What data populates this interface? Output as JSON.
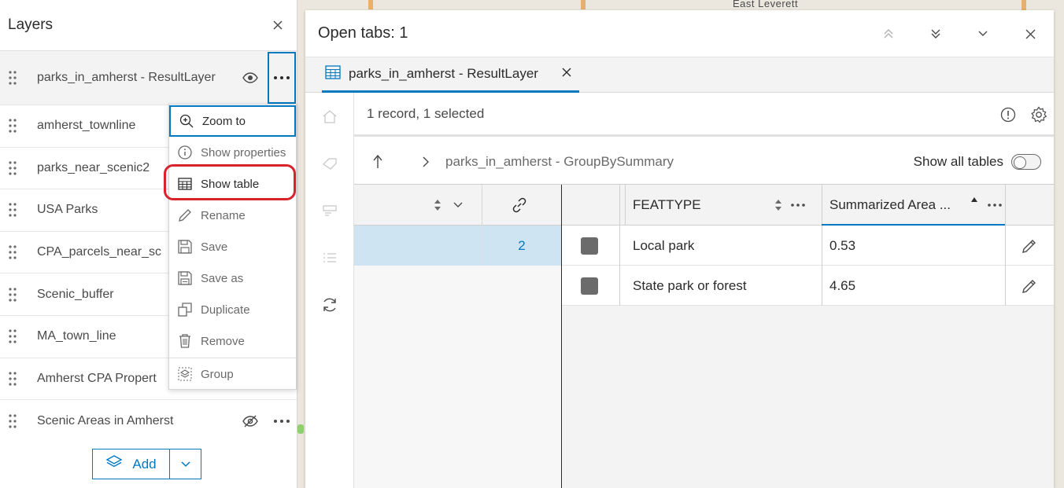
{
  "map": {
    "place_label": "East Leverett"
  },
  "layers_panel": {
    "title": "Layers",
    "close_icon": "close-icon",
    "layers": [
      {
        "label": "parks_in_amherst - ResultLayer",
        "visibility": "visible"
      },
      {
        "label": "amherst_townline"
      },
      {
        "label": "parks_near_scenic2"
      },
      {
        "label": "USA Parks"
      },
      {
        "label": "CPA_parcels_near_sc"
      },
      {
        "label": "Scenic_buffer"
      },
      {
        "label": "MA_town_line"
      },
      {
        "label": "Amherst CPA Propert"
      },
      {
        "label": "Scenic Areas in Amherst",
        "visibility": "hidden"
      }
    ],
    "add_button_label": "Add"
  },
  "context_menu": {
    "items": [
      {
        "label": "Zoom to",
        "icon": "zoom-in-icon"
      },
      {
        "label": "Show properties",
        "icon": "info-icon"
      },
      {
        "label": "Show table",
        "icon": "table-icon"
      },
      {
        "label": "Rename",
        "icon": "pencil-icon"
      },
      {
        "label": "Save",
        "icon": "save-icon"
      },
      {
        "label": "Save as",
        "icon": "save-as-icon"
      },
      {
        "label": "Duplicate",
        "icon": "duplicate-icon"
      },
      {
        "label": "Remove",
        "icon": "trash-icon"
      },
      {
        "label": "Group",
        "icon": "group-icon"
      }
    ],
    "highlight_color": "#d9232a"
  },
  "table_panel": {
    "title": "Open tabs: 1",
    "tab_label": "parks_in_amherst - ResultLayer",
    "records_text": "1 record, 1 selected",
    "breadcrumb": "parks_in_amherst - GroupBySummary",
    "show_all_tables_label": "Show all tables",
    "related_count": "2",
    "columns": [
      {
        "label": "FEATTYPE"
      },
      {
        "label": "Summarized Area ..."
      }
    ],
    "rows": [
      {
        "feattype": "Local park",
        "area": "0.53"
      },
      {
        "feattype": "State park or forest",
        "area": "4.65"
      }
    ]
  },
  "colors": {
    "accent": "#0079c1",
    "selected_row": "#cfe4f3",
    "swatch": "#6b6b6b"
  }
}
